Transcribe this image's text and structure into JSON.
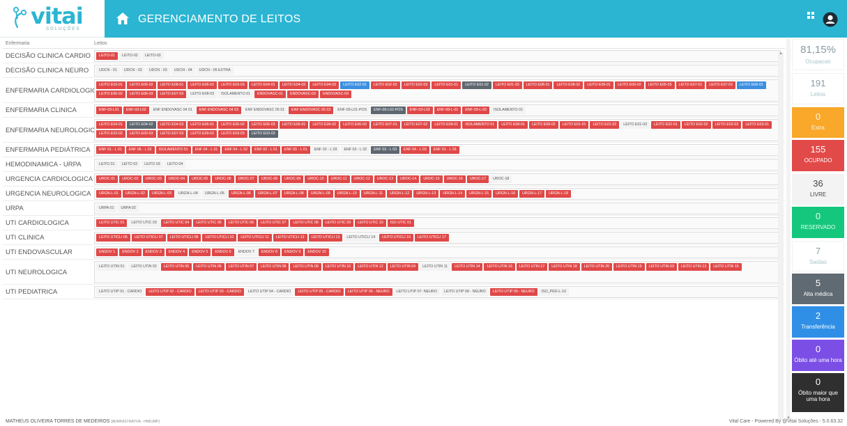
{
  "header": {
    "logo_text": "vitai",
    "logo_sub": "SOLUÇÕES",
    "title": "GERENCIAMENTO DE LEITOS",
    "icons": [
      "home-icon",
      "grid-icon",
      "user-icon"
    ],
    "color": "#2bb5d2"
  },
  "table": {
    "col_ward": "Enfermaria",
    "col_beds": "Leitos",
    "rows": [
      {
        "ward": "DECISÃO CLINICA CARDIO",
        "beds": [
          [
            "LEITO-01",
            "occ"
          ],
          [
            "LEITO-02",
            "free"
          ],
          [
            "LEITO-03",
            "free"
          ]
        ]
      },
      {
        "ward": "DECISÃO CLINICA NEURO",
        "beds": [
          [
            "UDCN - 01",
            "free"
          ],
          [
            "UDCN - 02",
            "free"
          ],
          [
            "UDCN - 03",
            "free"
          ],
          [
            "UDCN - 04",
            "free"
          ],
          [
            "UDCN - 05 EXTRA",
            "free"
          ]
        ]
      },
      {
        "ward": "ENFERMARIA CARDIOLOGICA",
        "beds": [
          [
            "LEITO E03-01",
            "occ"
          ],
          [
            "LEITO E05-02",
            "occ"
          ],
          [
            "LEITO E08-01",
            "occ"
          ],
          [
            "LEITO E06-02",
            "occ"
          ],
          [
            "LEITO E03-03",
            "occ"
          ],
          [
            "LEITO E04-01",
            "occ"
          ],
          [
            "LEITO E04-02",
            "occ"
          ],
          [
            "LEITO E04-03",
            "occ"
          ],
          [
            "LEITO E02-01",
            "blue"
          ],
          [
            "LEITO E02-02",
            "occ"
          ],
          [
            "LEITO E02-03",
            "occ"
          ],
          [
            "LEITO E01-01",
            "occ"
          ],
          [
            "LEITO E01-02",
            "dark"
          ],
          [
            "LEITO E01-03",
            "occ"
          ],
          [
            "LEITO E08-01",
            "occ"
          ],
          [
            "LEITO E08-02",
            "occ"
          ],
          [
            "LEITO E09-01",
            "occ"
          ],
          [
            "LEITO E09-02",
            "occ"
          ],
          [
            "LEITO E05-03",
            "occ"
          ],
          [
            "LEITO E07-01",
            "occ"
          ],
          [
            "LEITO E07-02",
            "occ"
          ],
          [
            "LEITO E06-01",
            "blue"
          ],
          [
            "LEITO E06-02",
            "occ"
          ],
          [
            "LEITO E06-03",
            "occ"
          ],
          [
            "LEITO E07-03",
            "occ"
          ],
          [
            "LEITO E08-03",
            "free"
          ],
          [
            "ISOLAMENTO 01",
            "free"
          ],
          [
            "ENDOVASC-01",
            "occ"
          ],
          [
            "ENDOVASC-02",
            "occ"
          ],
          [
            "ENDOVASC-03",
            "occ"
          ]
        ]
      },
      {
        "ward": "ENFERMARIA CLINICA",
        "beds": [
          [
            "ENF-03-L01",
            "occ"
          ],
          [
            "ENF-03-L02",
            "occ"
          ],
          [
            "ENF ENDOVASC 04 01",
            "free"
          ],
          [
            "ENF ENDOVASC 04 03",
            "occ"
          ],
          [
            "ENF ENDOVASC 05 01",
            "free"
          ],
          [
            "ENF ENDOVASC 05 03",
            "occ"
          ],
          [
            "ENF-09-L01-POS",
            "free"
          ],
          [
            "ENF-09-L02-POS",
            "dark"
          ],
          [
            "ENF-03-L03",
            "occ"
          ],
          [
            "ENF-08-L-01",
            "occ"
          ],
          [
            "ENF-09-L-03",
            "occ"
          ],
          [
            "ISOLAMENTO 01",
            "free"
          ]
        ]
      },
      {
        "ward": "ENFERMARIA NEUROLOGICA",
        "beds": [
          [
            "LEITO E04-01",
            "occ"
          ],
          [
            "LEITO E04-02",
            "dark"
          ],
          [
            "LEITO E04-03",
            "occ"
          ],
          [
            "LEITO E06-01",
            "occ"
          ],
          [
            "LEITO E06-02",
            "occ"
          ],
          [
            "LEITO E06-03",
            "occ"
          ],
          [
            "LEITO E06-01",
            "occ"
          ],
          [
            "LEITO E06-02",
            "occ"
          ],
          [
            "LEITO E06-03",
            "occ"
          ],
          [
            "LEITO E07-01",
            "occ"
          ],
          [
            "LEITO E07-02",
            "occ"
          ],
          [
            "LEITO E09-01",
            "occ"
          ],
          [
            "ISOLAMENTO 01",
            "occ"
          ],
          [
            "LEITO E08-01",
            "occ"
          ],
          [
            "LEITO E08-02",
            "occ"
          ],
          [
            "LEITO E01-01",
            "occ"
          ],
          [
            "LEITO E01-02",
            "occ"
          ],
          [
            "LEITO E01-03",
            "free"
          ],
          [
            "LEITO E02-01",
            "occ"
          ],
          [
            "LEITO E02-02",
            "occ"
          ],
          [
            "LEITO E02-03",
            "occ"
          ],
          [
            "LEITO E03-01",
            "occ"
          ],
          [
            "LEITO E03-02",
            "occ"
          ],
          [
            "LEITO E03-03",
            "occ"
          ],
          [
            "LEITO E07-03",
            "occ"
          ],
          [
            "LEITO E09-02",
            "occ"
          ],
          [
            "LEITO E09-03",
            "occ"
          ],
          [
            "LEITO E03-03",
            "dark"
          ]
        ]
      },
      {
        "ward": "ENFERMARIA PEDIÁTRICA",
        "beds": [
          [
            "ENF 01 - L 01",
            "occ"
          ],
          [
            "ENF 06 - L 02",
            "occ"
          ],
          [
            "ISOLAMENTO 01",
            "occ"
          ],
          [
            "ENF 04 - L 01",
            "occ"
          ],
          [
            "ENF 04 - L 02",
            "occ"
          ],
          [
            "ENF 02 - L 01",
            "occ"
          ],
          [
            "ENF 03 - L 01",
            "occ"
          ],
          [
            "ENF 02 - L 03",
            "free"
          ],
          [
            "ENF 03 - L 02",
            "free"
          ],
          [
            "ENF 03 - L 03",
            "dark"
          ],
          [
            "ENF 04 - L 03",
            "occ"
          ],
          [
            "ENF 01 - L 03",
            "occ"
          ]
        ]
      },
      {
        "ward": "HEMODINAMICA - URPA",
        "beds": [
          [
            "LEITO 01",
            "free"
          ],
          [
            "LEITO 02",
            "free"
          ],
          [
            "LEITO 03",
            "free"
          ],
          [
            "LEITO 04",
            "free"
          ]
        ]
      },
      {
        "ward": "URGENCIA CARDIOLOGICA",
        "beds": [
          [
            "UROC-01",
            "occ"
          ],
          [
            "UROC-02",
            "occ"
          ],
          [
            "UROC-03",
            "occ"
          ],
          [
            "UROC-04",
            "occ"
          ],
          [
            "UROC-05",
            "occ"
          ],
          [
            "UROC-06",
            "occ"
          ],
          [
            "UROC-07",
            "occ"
          ],
          [
            "UROC-08",
            "occ"
          ],
          [
            "UROC-09",
            "occ"
          ],
          [
            "UROC-10",
            "occ"
          ],
          [
            "UROC-11",
            "occ"
          ],
          [
            "UROC-12",
            "occ"
          ],
          [
            "UROC-13",
            "occ"
          ],
          [
            "UROC-14",
            "occ"
          ],
          [
            "UROC-15",
            "occ"
          ],
          [
            "UROC-16",
            "occ"
          ],
          [
            "UROC-17",
            "occ"
          ],
          [
            "UROC-18",
            "free"
          ]
        ]
      },
      {
        "ward": "URGENCIA NEUROLOGICA",
        "beds": [
          [
            "URGN-L-01",
            "occ"
          ],
          [
            "URGN-L-02",
            "occ"
          ],
          [
            "URGN-L-03",
            "occ"
          ],
          [
            "URGN-L-04",
            "free"
          ],
          [
            "URGN-L-05",
            "free"
          ],
          [
            "URGN-L-06",
            "occ"
          ],
          [
            "URGN-L-07",
            "occ"
          ],
          [
            "URGN-L-08",
            "occ"
          ],
          [
            "URGN-L-09",
            "occ"
          ],
          [
            "URGN-L-10",
            "occ"
          ],
          [
            "URGN-L-11",
            "occ"
          ],
          [
            "URGN-L-12",
            "occ"
          ],
          [
            "URGN-L-13",
            "occ"
          ],
          [
            "URGN-L-14",
            "occ"
          ],
          [
            "URGN-L-15",
            "occ"
          ],
          [
            "URGN-L-16",
            "occ"
          ],
          [
            "URGN-L-17",
            "occ"
          ],
          [
            "URGN-L-18",
            "occ"
          ]
        ]
      },
      {
        "ward": "URPA",
        "beds": [
          [
            "URPA 01",
            "free"
          ],
          [
            "URPA 02",
            "free"
          ]
        ]
      },
      {
        "ward": "UTI CARDIOLOGICA",
        "beds": [
          [
            "LEITO UTIC 01",
            "occ"
          ],
          [
            "LEITO UTIC 03",
            "free"
          ],
          [
            "LEITO UTIC 04",
            "occ"
          ],
          [
            "LEITO UTIC 05",
            "occ"
          ],
          [
            "LEITO UTIC 06",
            "occ"
          ],
          [
            "LEITO UTIC 07",
            "occ"
          ],
          [
            "LEITO UTIC 08",
            "occ"
          ],
          [
            "LEITO UTIC 09",
            "occ"
          ],
          [
            "LEITO UTIC 10",
            "occ"
          ],
          [
            "ISO UTIC 01",
            "occ"
          ]
        ]
      },
      {
        "ward": "UTI CLINICA",
        "beds": [
          [
            "LEITO UTICLI 06",
            "occ"
          ],
          [
            "LEITO UTICLI 07",
            "occ"
          ],
          [
            "LEITO UTICLI 08",
            "occ"
          ],
          [
            "LEITO UTICLI 10",
            "occ"
          ],
          [
            "LEITO UTICLI 11",
            "occ"
          ],
          [
            "LEITO UTICLI 12",
            "occ"
          ],
          [
            "LEITO UTICLI 13",
            "occ"
          ],
          [
            "LEITO UTICLI 14",
            "free"
          ],
          [
            "LEITO UTICLI 15",
            "occ"
          ],
          [
            "LEITO UTICLI 17",
            "occ"
          ]
        ]
      },
      {
        "ward": "UTI ENDOVASCULAR",
        "beds": [
          [
            "ENDOV 1",
            "occ"
          ],
          [
            "ENDOV 2",
            "occ"
          ],
          [
            "ENDOV 3",
            "occ"
          ],
          [
            "ENDOV 4",
            "occ"
          ],
          [
            "ENDOV 5",
            "occ"
          ],
          [
            "ENDOV 6",
            "occ"
          ],
          [
            "ENDOV 7",
            "free"
          ],
          [
            "ENDOV 8",
            "occ"
          ],
          [
            "ENDOV 9",
            "occ"
          ],
          [
            "ENDOV 10",
            "occ"
          ]
        ]
      },
      {
        "ward": "UTI NEUROLOGICA",
        "beds": [
          [
            "LEITO UTIN 01",
            "free"
          ],
          [
            "LEITO UTIN 02",
            "free"
          ],
          [
            "LEITO UTIN 05",
            "occ"
          ],
          [
            "LEITO UTIN 06",
            "occ"
          ],
          [
            "LEITO UTIN 07",
            "occ"
          ],
          [
            "LEITO UTIN 08",
            "occ"
          ],
          [
            "LEITO UTIN 09",
            "occ"
          ],
          [
            "LEITO UTIN 10",
            "occ"
          ],
          [
            "LEITO UTIN 12",
            "occ"
          ],
          [
            "LEITO UTIN 04",
            "occ"
          ],
          [
            "LEITO UTIN 11",
            "free"
          ],
          [
            "LEITO UTIN 14",
            "occ"
          ],
          [
            "LEITO UTIN 16",
            "occ"
          ],
          [
            "LEITO UTIN 17",
            "occ"
          ],
          [
            "LEITO UTIN 18",
            "occ"
          ],
          [
            "LEITO UTIN 20",
            "occ"
          ],
          [
            "LEITO UTIN 19",
            "occ"
          ],
          [
            "LEITO UTIN 03",
            "occ"
          ],
          [
            "LEITO UTIN 13",
            "occ"
          ],
          [
            "LEITO UTIN 15",
            "occ"
          ]
        ]
      },
      {
        "ward": "UTI PEDIATRICA",
        "beds": [
          [
            "LEITO UTIP 01 - CARDIO",
            "free"
          ],
          [
            "LEITO UTIP 02 - CARDIO",
            "occ"
          ],
          [
            "LEITO UTIP 03 - CARDIO",
            "occ"
          ],
          [
            "LEITO UTIP 04 - CARDIO",
            "free"
          ],
          [
            "LEITO UTIP 05 - CARDIO",
            "occ"
          ],
          [
            "LEITO UTIP 06 - NEURO",
            "occ"
          ],
          [
            "LEITO UTIP 07- NEURO",
            "free"
          ],
          [
            "LEITO UTIP 08 - NEURO",
            "free"
          ],
          [
            "LEITO UTIP 09 - NEURO",
            "occ"
          ],
          [
            "ISO_PED-L-10",
            "free"
          ]
        ]
      }
    ]
  },
  "stats": [
    {
      "name": "ocupacao",
      "value": "81,15%",
      "label": "Ocupacao",
      "bg": "#ffffff",
      "color": "#8a9ba3",
      "label_color": "#a9c4ca"
    },
    {
      "name": "leitos",
      "value": "191",
      "label": "Leitos",
      "bg": "#ffffff",
      "color": "#8a9ba3",
      "label_color": "#a9c4ca"
    },
    {
      "name": "extra",
      "value": "0",
      "label": "Extra",
      "bg": "#f9a82a",
      "color": "#fff6e0",
      "label_color": "#fff6e0"
    },
    {
      "name": "ocupado",
      "value": "155",
      "label": "OCUPADO",
      "bg": "#e24a4a",
      "color": "#ffffff",
      "label_color": "#ffffff"
    },
    {
      "name": "livre",
      "value": "36",
      "label": "LIVRE",
      "bg": "#f3f3f3",
      "color": "#444444",
      "label_color": "#444444"
    },
    {
      "name": "reservado",
      "value": "0",
      "label": "RESERVADO",
      "bg": "#15c77c",
      "color": "#e3fff1",
      "label_color": "#e3fff1"
    },
    {
      "name": "saidas",
      "value": "7",
      "label": "Saídas",
      "bg": "#ffffff",
      "color": "#8a9ba3",
      "label_color": "#a9c4ca"
    },
    {
      "name": "alta-medica",
      "value": "5",
      "label": "Alta médica",
      "bg": "#5f6a73",
      "color": "#ffffff",
      "label_color": "#ffffff"
    },
    {
      "name": "transferencia",
      "value": "2",
      "label": "Transferência",
      "bg": "#2f8fe6",
      "color": "#ffffff",
      "label_color": "#ffffff"
    },
    {
      "name": "obito-ate-uma-hora",
      "value": "0",
      "label": "Óbito até uma hora",
      "bg": "#7b4ee6",
      "color": "#ffffff",
      "label_color": "#ffffff"
    },
    {
      "name": "obito-maior-que-uma-hora",
      "value": "0",
      "label": "Óbito maior que uma hora",
      "bg": "#2f2f2f",
      "color": "#ffffff",
      "label_color": "#ffffff"
    }
  ],
  "footer": {
    "user": "MATHEUS OLIVEIRA TORRES DE MEDEIROS",
    "role": "[ADMINISTRATIVA - HMDJMP]",
    "powered": "Vital Care - Powered By @Vitai Soluções - 5.0.63.32"
  }
}
